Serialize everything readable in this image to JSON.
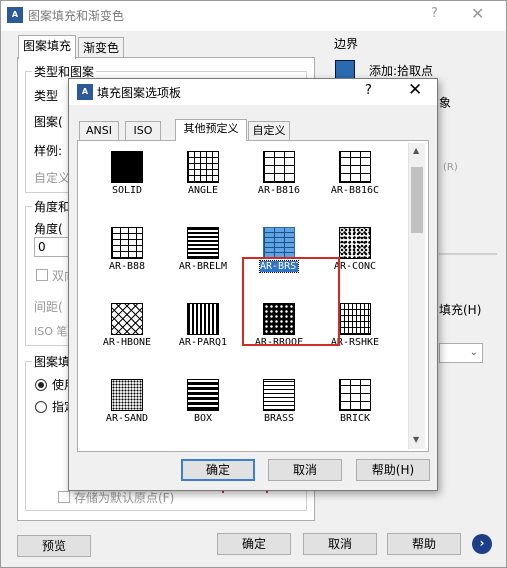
{
  "main": {
    "title": "图案填充和渐变色",
    "help_glyph": "?",
    "close_glyph": "✕",
    "tabs": [
      "图案填充",
      "渐变色"
    ],
    "type_pattern_group": "类型和图案",
    "type_label": "类型",
    "pattern_label": "图案(",
    "sample_label": "样例:",
    "custom_label": "自定义",
    "angle_group": "角度和",
    "angle_label": "角度(",
    "angle_value": "0",
    "double_label": "双向",
    "spacing_label": "间距(",
    "iso_label": "ISO 笔",
    "origin_group": "图案填",
    "use_label": "使用",
    "specify_label": "指定",
    "store_default": "存储为默认原点(F)",
    "boundary_group": "边界",
    "add_pick_points": "添加:拾取点",
    "right_frag_1": "象",
    "right_frag_2": "(R)",
    "right_frag_3": "填充(H)",
    "bottom_buttons": {
      "preview": "预览",
      "ok": "确定",
      "cancel": "取消",
      "help": "帮助"
    },
    "next_glyph": "›"
  },
  "popup": {
    "title": "填充图案选项板",
    "help_glyph": "?",
    "close_glyph": "✕",
    "tabs": [
      "ANSI",
      "ISO",
      "其他预定义",
      "自定义"
    ],
    "patterns": [
      {
        "name": "SOLID",
        "pattern": "solid"
      },
      {
        "name": "ANGLE",
        "pattern": "grid"
      },
      {
        "name": "AR-B816",
        "pattern": "brick"
      },
      {
        "name": "AR-B816C",
        "pattern": "brick"
      },
      {
        "name": "AR-B88",
        "pattern": "brick-small"
      },
      {
        "name": "AR-BRELM",
        "pattern": "dense-brick"
      },
      {
        "name": "AR-BRSTD",
        "pattern": "brick-blue"
      },
      {
        "name": "AR-CONC",
        "pattern": "speckle"
      },
      {
        "name": "AR-HBONE",
        "pattern": "herringbone"
      },
      {
        "name": "AR-PARQ1",
        "pattern": "parquet"
      },
      {
        "name": "AR-RROOF",
        "pattern": "roof"
      },
      {
        "name": "AR-RSHKE",
        "pattern": "shake"
      },
      {
        "name": "AR-SAND",
        "pattern": "sand"
      },
      {
        "name": "BOX",
        "pattern": "box"
      },
      {
        "name": "BRASS",
        "pattern": "lines"
      },
      {
        "name": "BRICK",
        "pattern": "brick"
      }
    ],
    "selected": "AR-BRSTD",
    "ok": "确定",
    "cancel": "取消",
    "help": "帮助(H)"
  },
  "colors": {
    "selection": "#3074c8",
    "highlight_box": "#d42a24",
    "default_button_border": "#3c7fd0"
  }
}
